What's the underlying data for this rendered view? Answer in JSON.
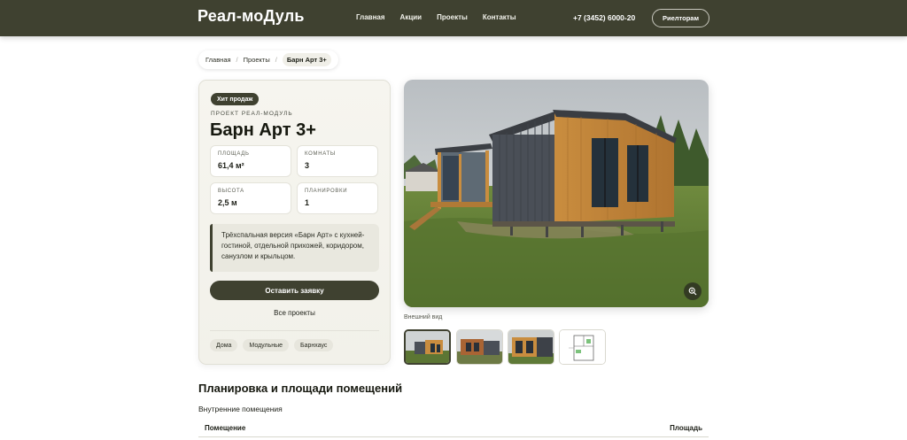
{
  "header": {
    "logo": "Реал-моДуль",
    "nav": [
      "Главная",
      "Акции",
      "Проекты",
      "Контакты"
    ],
    "phone": "+7 (3452) 6000-20",
    "realtor_button": "Риелторам"
  },
  "breadcrumb": {
    "items": [
      "Главная",
      "Проекты"
    ],
    "current": "Барн Арт 3+"
  },
  "project": {
    "badge": "Хит продаж",
    "eyebrow": "ПРОЕКТ РЕАЛ-МОДУЛЬ",
    "title": "Барн Арт 3+",
    "stats": [
      {
        "label": "ПЛОЩАДЬ",
        "value": "61,4 м²"
      },
      {
        "label": "КОМНАТЫ",
        "value": "3"
      },
      {
        "label": "ВЫСОТА",
        "value": "2,5 м"
      },
      {
        "label": "ПЛАНИРОВКИ",
        "value": "1"
      }
    ],
    "description": "Трёхспальная версия «Барн Арт» с кухней-гостиной, отдельной прихожей, коридором, санузлом и крыльцом.",
    "cta": "Оставить заявку",
    "all_projects": "Все проекты",
    "tags": [
      "Дома",
      "Модульные",
      "Барнхаус"
    ]
  },
  "gallery": {
    "caption": "Внешний вид",
    "zoom_icon": "zoom-in-icon",
    "thumbnails": [
      "exterior-1",
      "exterior-2",
      "exterior-3",
      "floor-plan"
    ],
    "active_index": 0
  },
  "plan_section": {
    "title": "Планировка и площади помещений",
    "subtitle": "Внутренние помещения",
    "columns": [
      "Помещение",
      "Площадь"
    ]
  },
  "colors": {
    "header_bg": "#3f4130",
    "accent": "#3f4130",
    "card_bg": "#f4f3ed"
  }
}
